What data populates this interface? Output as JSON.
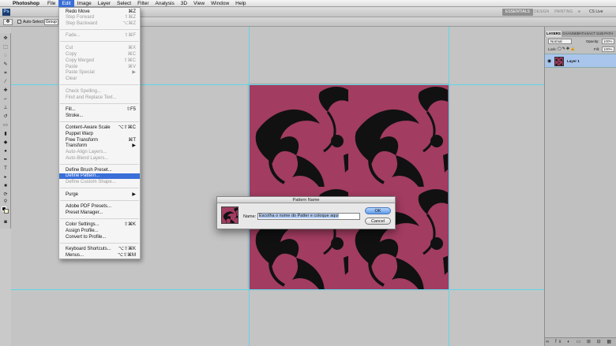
{
  "menubar": {
    "app_name": "Photoshop",
    "items": [
      "File",
      "Edit",
      "Image",
      "Layer",
      "Select",
      "Filter",
      "Analysis",
      "3D",
      "View",
      "Window",
      "Help"
    ],
    "active_item": "Edit"
  },
  "appbar": {
    "logo": "Ps",
    "workspaces": [
      "ESSENTIALS",
      "DESIGN",
      "PAINTING"
    ],
    "active_workspace": "ESSENTIALS",
    "more": "»",
    "cs_live": "CS Live"
  },
  "options_bar": {
    "auto_select_label": "Auto-Select:",
    "auto_select_value": "Group"
  },
  "edit_menu": {
    "items": [
      {
        "label": "Redo Move",
        "shortcut": "⌘Z",
        "enabled": true
      },
      {
        "label": "Step Forward",
        "shortcut": "⇧⌘Z",
        "enabled": false
      },
      {
        "label": "Step Backward",
        "shortcut": "⌥⌘Z",
        "enabled": false
      },
      {
        "label": "Fade...",
        "shortcut": "⇧⌘F",
        "enabled": false
      },
      {
        "label": "Cut",
        "shortcut": "⌘X",
        "enabled": false
      },
      {
        "label": "Copy",
        "shortcut": "⌘C",
        "enabled": false
      },
      {
        "label": "Copy Merged",
        "shortcut": "⇧⌘C",
        "enabled": false
      },
      {
        "label": "Paste",
        "shortcut": "⌘V",
        "enabled": false
      },
      {
        "label": "Paste Special",
        "shortcut": "▶",
        "enabled": false
      },
      {
        "label": "Clear",
        "shortcut": "",
        "enabled": false
      },
      {
        "label": "Check Spelling...",
        "shortcut": "",
        "enabled": false
      },
      {
        "label": "Find and Replace Text...",
        "shortcut": "",
        "enabled": false
      },
      {
        "label": "Fill...",
        "shortcut": "⇧F5",
        "enabled": true
      },
      {
        "label": "Stroke...",
        "shortcut": "",
        "enabled": true
      },
      {
        "label": "Content-Aware Scale",
        "shortcut": "⌥⇧⌘C",
        "enabled": true
      },
      {
        "label": "Puppet Warp",
        "shortcut": "",
        "enabled": true
      },
      {
        "label": "Free Transform",
        "shortcut": "⌘T",
        "enabled": true
      },
      {
        "label": "Transform",
        "shortcut": "▶",
        "enabled": true
      },
      {
        "label": "Auto-Align Layers...",
        "shortcut": "",
        "enabled": false
      },
      {
        "label": "Auto-Blend Layers...",
        "shortcut": "",
        "enabled": false
      },
      {
        "label": "Define Brush Preset...",
        "shortcut": "",
        "enabled": true
      },
      {
        "label": "Define Pattern...",
        "shortcut": "",
        "enabled": true,
        "highlighted": true
      },
      {
        "label": "Define Custom Shape...",
        "shortcut": "",
        "enabled": false
      },
      {
        "label": "Purge",
        "shortcut": "▶",
        "enabled": true
      },
      {
        "label": "Adobe PDF Presets...",
        "shortcut": "",
        "enabled": true
      },
      {
        "label": "Preset Manager...",
        "shortcut": "",
        "enabled": true
      },
      {
        "label": "Color Settings...",
        "shortcut": "⇧⌘K",
        "enabled": true
      },
      {
        "label": "Assign Profile...",
        "shortcut": "",
        "enabled": true
      },
      {
        "label": "Convert to Profile...",
        "shortcut": "",
        "enabled": true
      },
      {
        "label": "Keyboard Shortcuts...",
        "shortcut": "⌥⇧⌘K",
        "enabled": true
      },
      {
        "label": "Menus...",
        "shortcut": "⌥⇧⌘M",
        "enabled": true
      }
    ]
  },
  "layers_panel": {
    "tabs": [
      "LAYERS",
      "CHANNEL",
      "PATHS",
      "ACT",
      "SUB",
      "PATH"
    ],
    "active_tab": "LAYERS",
    "blend_mode": "Normal",
    "opacity_label": "Opacity:",
    "opacity_value": "100%",
    "lock_label": "Lock:",
    "fill_label": "Fill:",
    "fill_value": "100%",
    "layer_name": "Layer 1",
    "footer_icons": "∞ fx ◐ ▭ ⊞ ⊟ ▦"
  },
  "dialog": {
    "title": "Pattern Name",
    "name_label": "Name:",
    "name_value": "Escolha o nome do Patter e coloque aqui",
    "ok_label": "OK",
    "cancel_label": "Cancel"
  },
  "colors": {
    "pattern_bg": "#a23c60",
    "pattern_fg": "#111111",
    "menu_highlight": "#3a6fd8",
    "guide": "#5fd5e8"
  }
}
